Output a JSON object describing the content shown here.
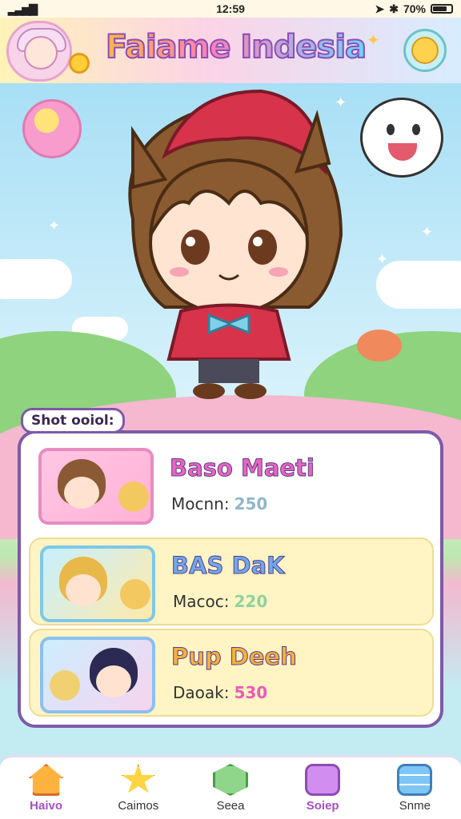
{
  "status_bar": {
    "time": "12:59",
    "battery": "70%"
  },
  "header": {
    "title": "Faiame Indesia"
  },
  "panel": {
    "label": "Shot ooiol:",
    "items": [
      {
        "name": "Baso Maeti",
        "stat_label": "Mocnn:",
        "stat_value": "250"
      },
      {
        "name": "BAS DaK",
        "stat_label": "Macoc:",
        "stat_value": "220"
      },
      {
        "name": "Pup Deeh",
        "stat_label": "Daoak:",
        "stat_value": "530"
      }
    ]
  },
  "nav": {
    "items": [
      {
        "label": "Haivo",
        "icon": "home-icon",
        "active": true
      },
      {
        "label": "Caimos",
        "icon": "star-icon",
        "active": false
      },
      {
        "label": "Seea",
        "icon": "gem-icon",
        "active": false
      },
      {
        "label": "Soiep",
        "icon": "shop-box-icon",
        "active": true
      },
      {
        "label": "Snme",
        "icon": "layers-icon",
        "active": false
      }
    ]
  }
}
